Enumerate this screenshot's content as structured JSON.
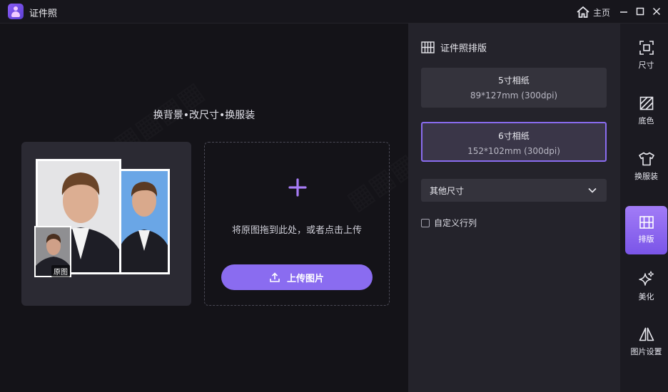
{
  "app": {
    "title": "证件照"
  },
  "titlebar": {
    "home_label": "主页"
  },
  "main": {
    "tagline": "换背景•改尺寸•换服装",
    "badge_original": "原图",
    "upload": {
      "hint": "将原图拖到此处，或者点击上传",
      "button_label": "上传图片"
    }
  },
  "panel": {
    "title": "证件照排版",
    "paper_options": [
      {
        "name": "5寸相纸",
        "spec": "89*127mm (300dpi)",
        "selected": false
      },
      {
        "name": "6寸相纸",
        "spec": "152*102mm (300dpi)",
        "selected": true
      }
    ],
    "other_size": "其他尺寸",
    "custom_label": "自定义行列"
  },
  "toolbar": {
    "items": [
      {
        "label": "尺寸",
        "icon": "crop-frame-icon"
      },
      {
        "label": "底色",
        "icon": "background-color-icon"
      },
      {
        "label": "换服装",
        "icon": "tshirt-icon"
      },
      {
        "label": "排版",
        "icon": "layout-grid-icon",
        "active": true
      },
      {
        "label": "美化",
        "icon": "sparkle-icon"
      },
      {
        "label": "图片设置",
        "icon": "mirror-icon"
      }
    ]
  },
  "colors": {
    "accent": "#8a6cf0",
    "panel_bg": "#24232b",
    "canvas_bg": "#141318"
  }
}
